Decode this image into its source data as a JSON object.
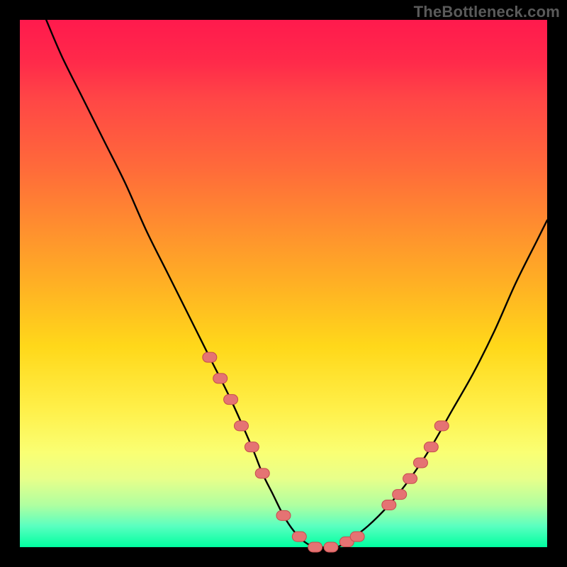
{
  "attribution": "TheBottleneck.com",
  "colors": {
    "page_bg": "#000000",
    "gradient_top": "#ff1a4d",
    "gradient_bottom": "#00ffa0",
    "curve": "#000000",
    "marker_fill": "#e57373",
    "marker_stroke": "#c44d4d"
  },
  "chart_data": {
    "type": "line",
    "title": "",
    "xlabel": "",
    "ylabel": "",
    "xlim": [
      0,
      100
    ],
    "ylim": [
      0,
      100
    ],
    "annotations": [],
    "series": [
      {
        "name": "curve",
        "x": [
          5,
          8,
          12,
          16,
          20,
          24,
          28,
          32,
          36,
          40,
          44,
          46,
          48,
          50,
          52,
          54,
          56,
          58,
          60,
          62,
          66,
          70,
          74,
          78,
          82,
          86,
          90,
          94,
          98,
          100
        ],
        "values": [
          100,
          93,
          85,
          77,
          69,
          60,
          52,
          44,
          36,
          28,
          19,
          14,
          10,
          6,
          3,
          1,
          0,
          0,
          0,
          1,
          4,
          8,
          13,
          19,
          26,
          33,
          41,
          50,
          58,
          62
        ]
      }
    ],
    "markers": {
      "name": "highlight-points",
      "x": [
        36,
        38,
        40,
        42,
        44,
        46,
        50,
        53,
        56,
        59,
        62,
        64,
        70,
        72,
        74,
        76,
        78,
        80
      ],
      "values": [
        36,
        32,
        28,
        23,
        19,
        14,
        6,
        2,
        0,
        0,
        1,
        2,
        8,
        10,
        13,
        16,
        19,
        23
      ]
    }
  }
}
